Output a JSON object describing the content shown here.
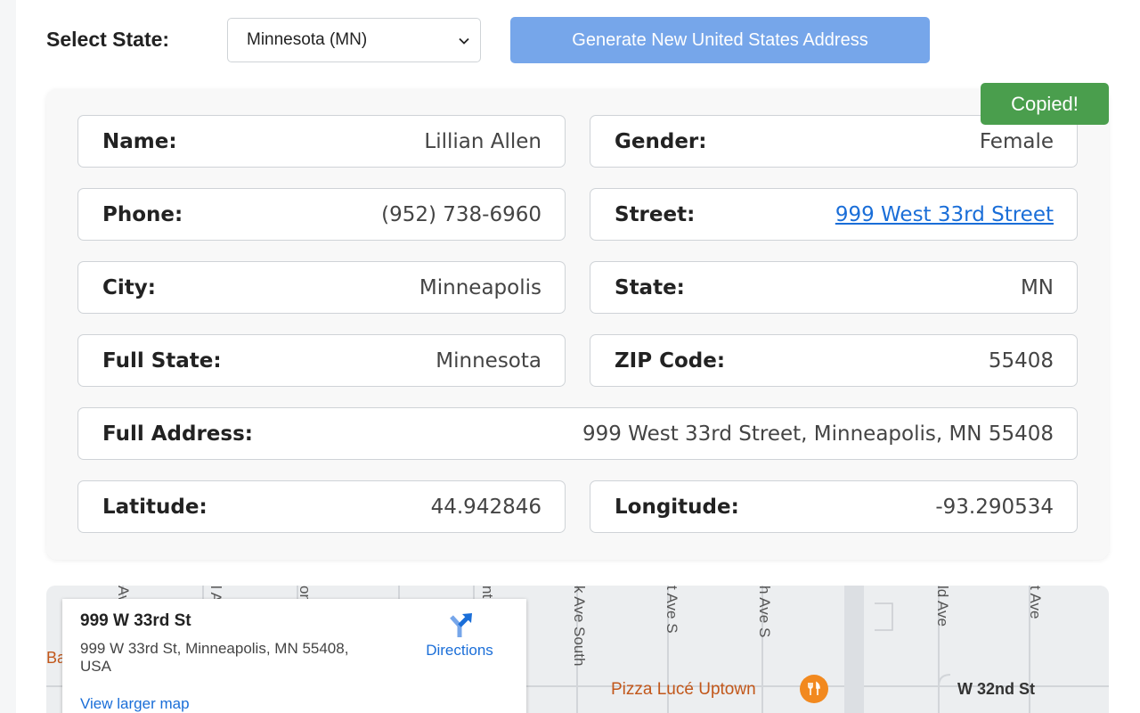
{
  "controls": {
    "state_label": "Select State:",
    "state_selected": "Minnesota (MN)",
    "generate_label": "Generate New United States Address"
  },
  "toast": {
    "copied": "Copied!"
  },
  "fields": {
    "name": {
      "label": "Name:",
      "value": "Lillian Allen"
    },
    "gender": {
      "label": "Gender:",
      "value": "Female"
    },
    "phone": {
      "label": "Phone:",
      "value": "(952) 738-6960"
    },
    "street": {
      "label": "Street:",
      "value": "999 West 33rd Street"
    },
    "city": {
      "label": "City:",
      "value": "Minneapolis"
    },
    "state": {
      "label": "State:",
      "value": "MN"
    },
    "full_state": {
      "label": "Full State:",
      "value": "Minnesota"
    },
    "zip": {
      "label": "ZIP Code:",
      "value": "55408"
    },
    "full_address": {
      "label": "Full Address:",
      "value": "999 West 33rd Street, Minneapolis, MN 55408"
    },
    "latitude": {
      "label": "Latitude:",
      "value": "44.942846"
    },
    "longitude": {
      "label": "Longitude:",
      "value": "-93.290534"
    }
  },
  "map": {
    "place_name": "999 W 33rd St",
    "place_address": "999 W 33rd St, Minneapolis, MN 55408, USA",
    "directions_label": "Directions",
    "view_larger_label": "View larger map",
    "poi_label": "Pizza Lucé Uptown",
    "cross_street": "W 32nd St",
    "edge_label": "Ba",
    "street_labels": [
      "Av",
      "l A",
      "on",
      "nt",
      "k Ave South",
      "t Ave S",
      "h Ave S",
      "ld Ave",
      "t Ave"
    ]
  },
  "colors": {
    "accent_button": "#76a6ea",
    "toast_green": "#4a9e4d",
    "link_blue": "#1a6ed8",
    "poi_orange": "#f2891f"
  }
}
